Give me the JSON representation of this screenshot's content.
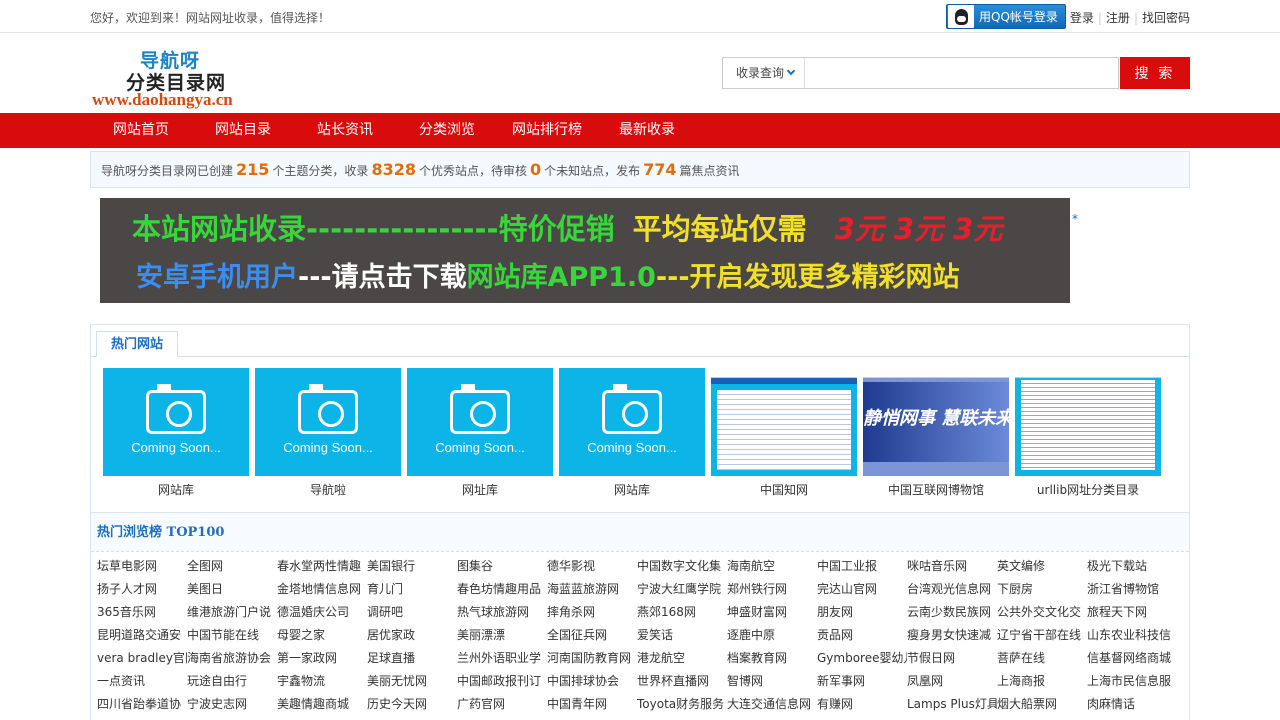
{
  "topbar": {
    "welcome": "您好，欢迎到来！网站网址收录，值得选择！",
    "qq_login": "用QQ帐号登录",
    "login": "登录",
    "register": "注册",
    "recover": "找回密码"
  },
  "logo": {
    "line1": "导航呀",
    "line2": "分类目录网",
    "line3": "www.daohangya.cn"
  },
  "search": {
    "select_value": "收录查询",
    "input_value": "",
    "button": "搜 索"
  },
  "nav": [
    "网站首页",
    "网站目录",
    "站长资讯",
    "分类浏览",
    "网站排行榜",
    "最新收录"
  ],
  "stats": {
    "t1": "导航呀分类目录网已创建",
    "categories": "215",
    "t2": "个主题分类，收录",
    "sites": "8328",
    "t3": "个优秀站点，待审核",
    "pending": "0",
    "t4": "个未知站点，发布",
    "articles": "774",
    "t5": "篇焦点资讯"
  },
  "banner": {
    "l1a": "本站网站收录",
    "l1b": "----------------",
    "l1c": "特价促销",
    "l1d": "平均每站仅需",
    "l1e": "3元 3元 3元",
    "l2a": "安卓手机用户",
    "l2b": "---请点击下载",
    "l2c": "网站库APP1.0",
    "l2d": "---开启发现更多精彩网站",
    "star": "*"
  },
  "hot": {
    "tab": "热门网站",
    "placeholder_text": "Coming Soon...",
    "shot_text": "静悄网事 慧联未来",
    "sites": [
      "网站库",
      "导航啦",
      "网址库",
      "网站库",
      "中国知网",
      "中国互联网博物馆",
      "urllib网址分类目录"
    ]
  },
  "top100": {
    "title": "热门浏览榜 TOP100",
    "rows": [
      [
        "坛草电影网",
        "全图网",
        "春水堂两性情趣",
        "美国银行",
        "图集谷",
        "德华影视",
        "中国数字文化集",
        "海南航空",
        "中国工业报",
        "咪咕音乐网",
        "英文编修",
        "极光下载站"
      ],
      [
        "扬子人才网",
        "美图日",
        "金塔地情信息网",
        "育儿门",
        "春色坊情趣用品",
        "海蓝蓝旅游网",
        "宁波大红鹰学院",
        "郑州铁行网",
        "完达山官网",
        "台湾观光信息网",
        "下厨房",
        "浙江省博物馆"
      ],
      [
        "365音乐网",
        "维港旅游门户说",
        "德温婚庆公司",
        "调研吧",
        "热气球旅游网",
        "摔角杀网",
        "燕郊168网",
        "坤盛财富网",
        "朋友网",
        "云南少数民族网",
        "公共外交文化交",
        "旅程天下网"
      ],
      [
        "昆明道路交通安",
        "中国节能在线",
        "母婴之家",
        "居优家政",
        "美丽漂漂",
        "全国征兵网",
        "爱笑话",
        "逐鹿中原",
        "贡品网",
        "瘦身男女快速减",
        "辽宁省干部在线",
        "山东农业科技信"
      ],
      [
        "vera bradley官网",
        "海南省旅游协会",
        "第一家政网",
        "足球直播",
        "兰州外语职业学",
        "河南国防教育网",
        "港龙航空",
        "档案教育网",
        "Gymboree婴幼儿",
        "节假日网",
        "菩萨在线",
        "信基督网络商城"
      ],
      [
        "一点资讯",
        "玩途自由行",
        "宇鑫物流",
        "美丽无忧网",
        "中国邮政报刊订",
        "中国排球协会",
        "世界杯直播网",
        "智博网",
        "新军事网",
        "凤凰网",
        "上海商报",
        "上海市民信息服"
      ],
      [
        "四川省跆拳道协",
        "宁波史志网",
        "美趣情趣商城",
        "历史今天网",
        "广药官网",
        "中国青年网",
        "Toyota财务服务",
        "大连交通信息网",
        "有赚网",
        "Lamps Plus灯具",
        "烟大船票网",
        "肉麻情话"
      ]
    ]
  }
}
